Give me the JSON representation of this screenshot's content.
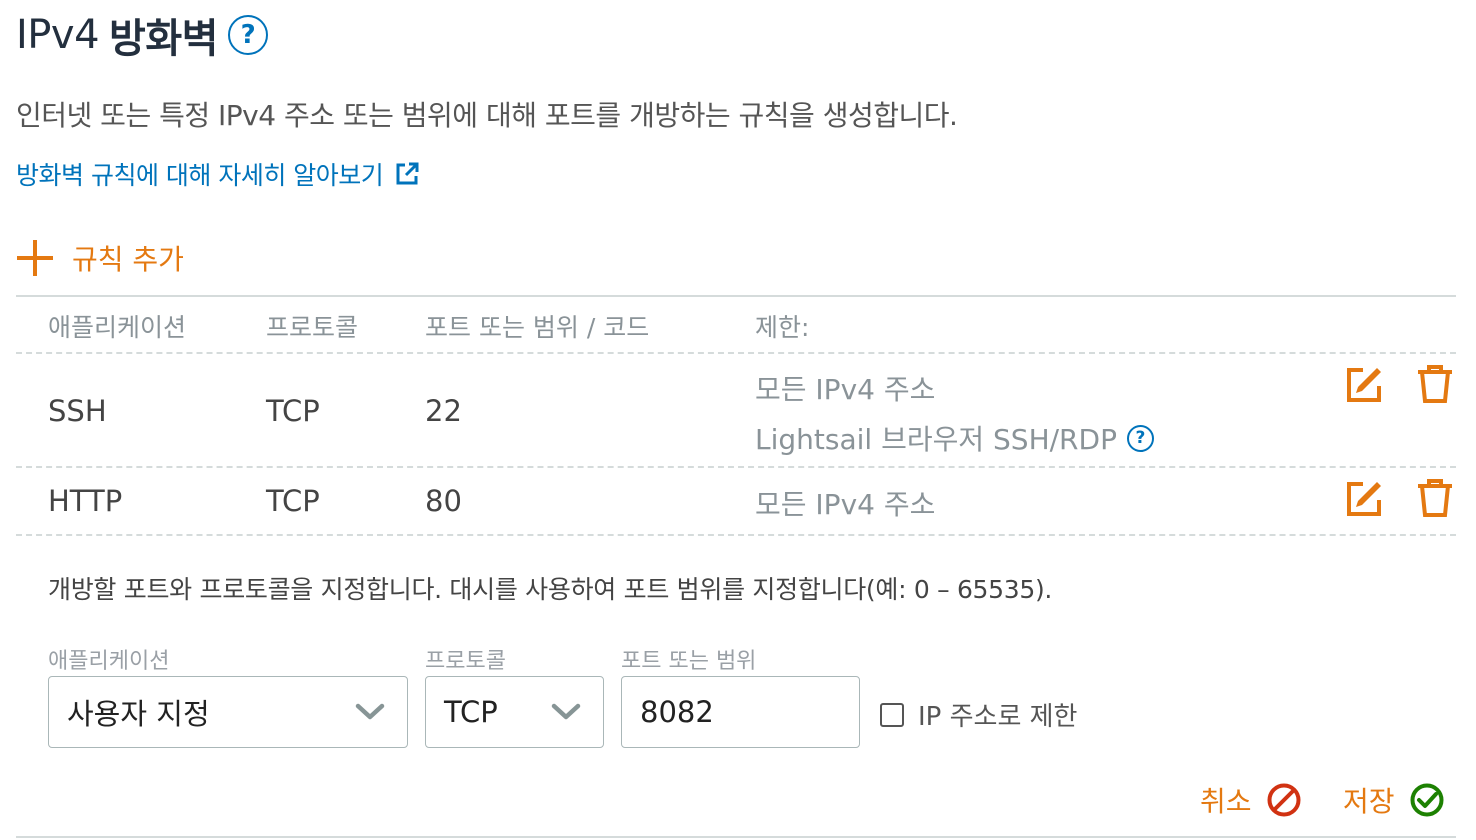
{
  "header": {
    "title_prefix": "IPv4",
    "title_bold": "방화벽",
    "help_glyph": "?",
    "description": "인터넷 또는 특정 IPv4 주소 또는 범위에 대해 포트를 개방하는 규칙을 생성합니다.",
    "learn_more_link": "방화벽 규칙에 대해 자세히 알아보기"
  },
  "add_rule_label": "규칙 추가",
  "table": {
    "columns": [
      "애플리케이션",
      "프로토콜",
      "포트 또는 범위 / 코드",
      "제한:"
    ],
    "rows": [
      {
        "application": "SSH",
        "protocol": "TCP",
        "port": "22",
        "restriction_1": "모든 IPv4 주소",
        "restriction_2": "Lightsail 브라우저 SSH/RDP"
      },
      {
        "application": "HTTP",
        "protocol": "TCP",
        "port": "80",
        "restriction_1": "모든 IPv4 주소"
      }
    ]
  },
  "edit_form": {
    "instructions": "개방할 포트와 프로토콜을 지정합니다. 대시를 사용하여 포트 범위를 지정합니다(예: 0 – 65535).",
    "application_label": "애플리케이션",
    "application_value": "사용자 지정",
    "protocol_label": "프로토콜",
    "protocol_value": "TCP",
    "port_label": "포트 또는 범위",
    "port_value": "8082",
    "restrict_checkbox_label": "IP 주소로 제한",
    "restrict_checked": false,
    "cancel_label": "취소",
    "save_label": "저장"
  },
  "colors": {
    "accent_orange": "#e47911",
    "link_blue": "#0073bb",
    "cancel_red": "#d13212",
    "save_green": "#1d8102",
    "border_gray": "#d5dbdb"
  },
  "icons": {
    "help": "help-circle-icon",
    "external_link": "external-link-icon",
    "add": "plus-icon",
    "edit": "edit-icon",
    "delete": "trash-icon",
    "dropdown": "chevron-down-icon",
    "cancel": "prohibited-icon",
    "save": "check-circle-icon"
  }
}
